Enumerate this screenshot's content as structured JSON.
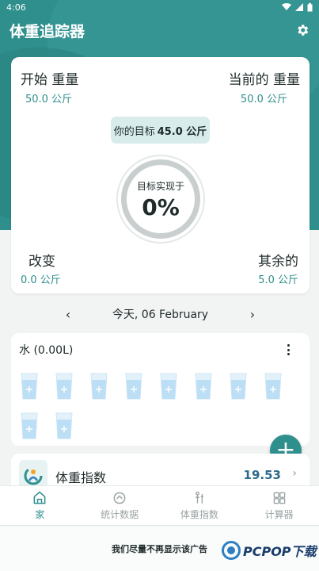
{
  "status_bar": {
    "time": "4:06"
  },
  "app_bar": {
    "title": "体重追踪器"
  },
  "summary": {
    "start_label": "开始 重量",
    "start_value": "50.0 公斤",
    "current_label": "当前的 重量",
    "current_value": "50.0 公斤",
    "goal_prefix": "你的目标",
    "goal_value": "45.0 公斤",
    "achieved_label": "目标实现于",
    "achieved_percent": "0%",
    "change_label": "改变",
    "change_value": "0.0 公斤",
    "remaining_label": "其余的",
    "remaining_value": "5.0 公斤"
  },
  "date_nav": {
    "prev": "‹",
    "date": "今天, 06 February",
    "next": "›"
  },
  "water": {
    "title": "水 (0.00L)",
    "cups_total": 10,
    "cups_filled": 0
  },
  "bmi": {
    "title": "体重指数",
    "value": "19.53"
  },
  "bottom_nav": [
    {
      "label": "家",
      "icon": "home-icon",
      "active": true
    },
    {
      "label": "统计数据",
      "icon": "stats-icon",
      "active": false
    },
    {
      "label": "体重指数",
      "icon": "bmi-icon",
      "active": false
    },
    {
      "label": "计算器",
      "icon": "calculator-icon",
      "active": false
    }
  ],
  "ad": {
    "text": "我们尽量不再显示该广告"
  },
  "watermark": {
    "text": "PCPOP下载"
  },
  "colors": {
    "primary": "#2f8f8c",
    "accent_light": "#d8ecec",
    "bmi_value": "#2f6a8a"
  }
}
